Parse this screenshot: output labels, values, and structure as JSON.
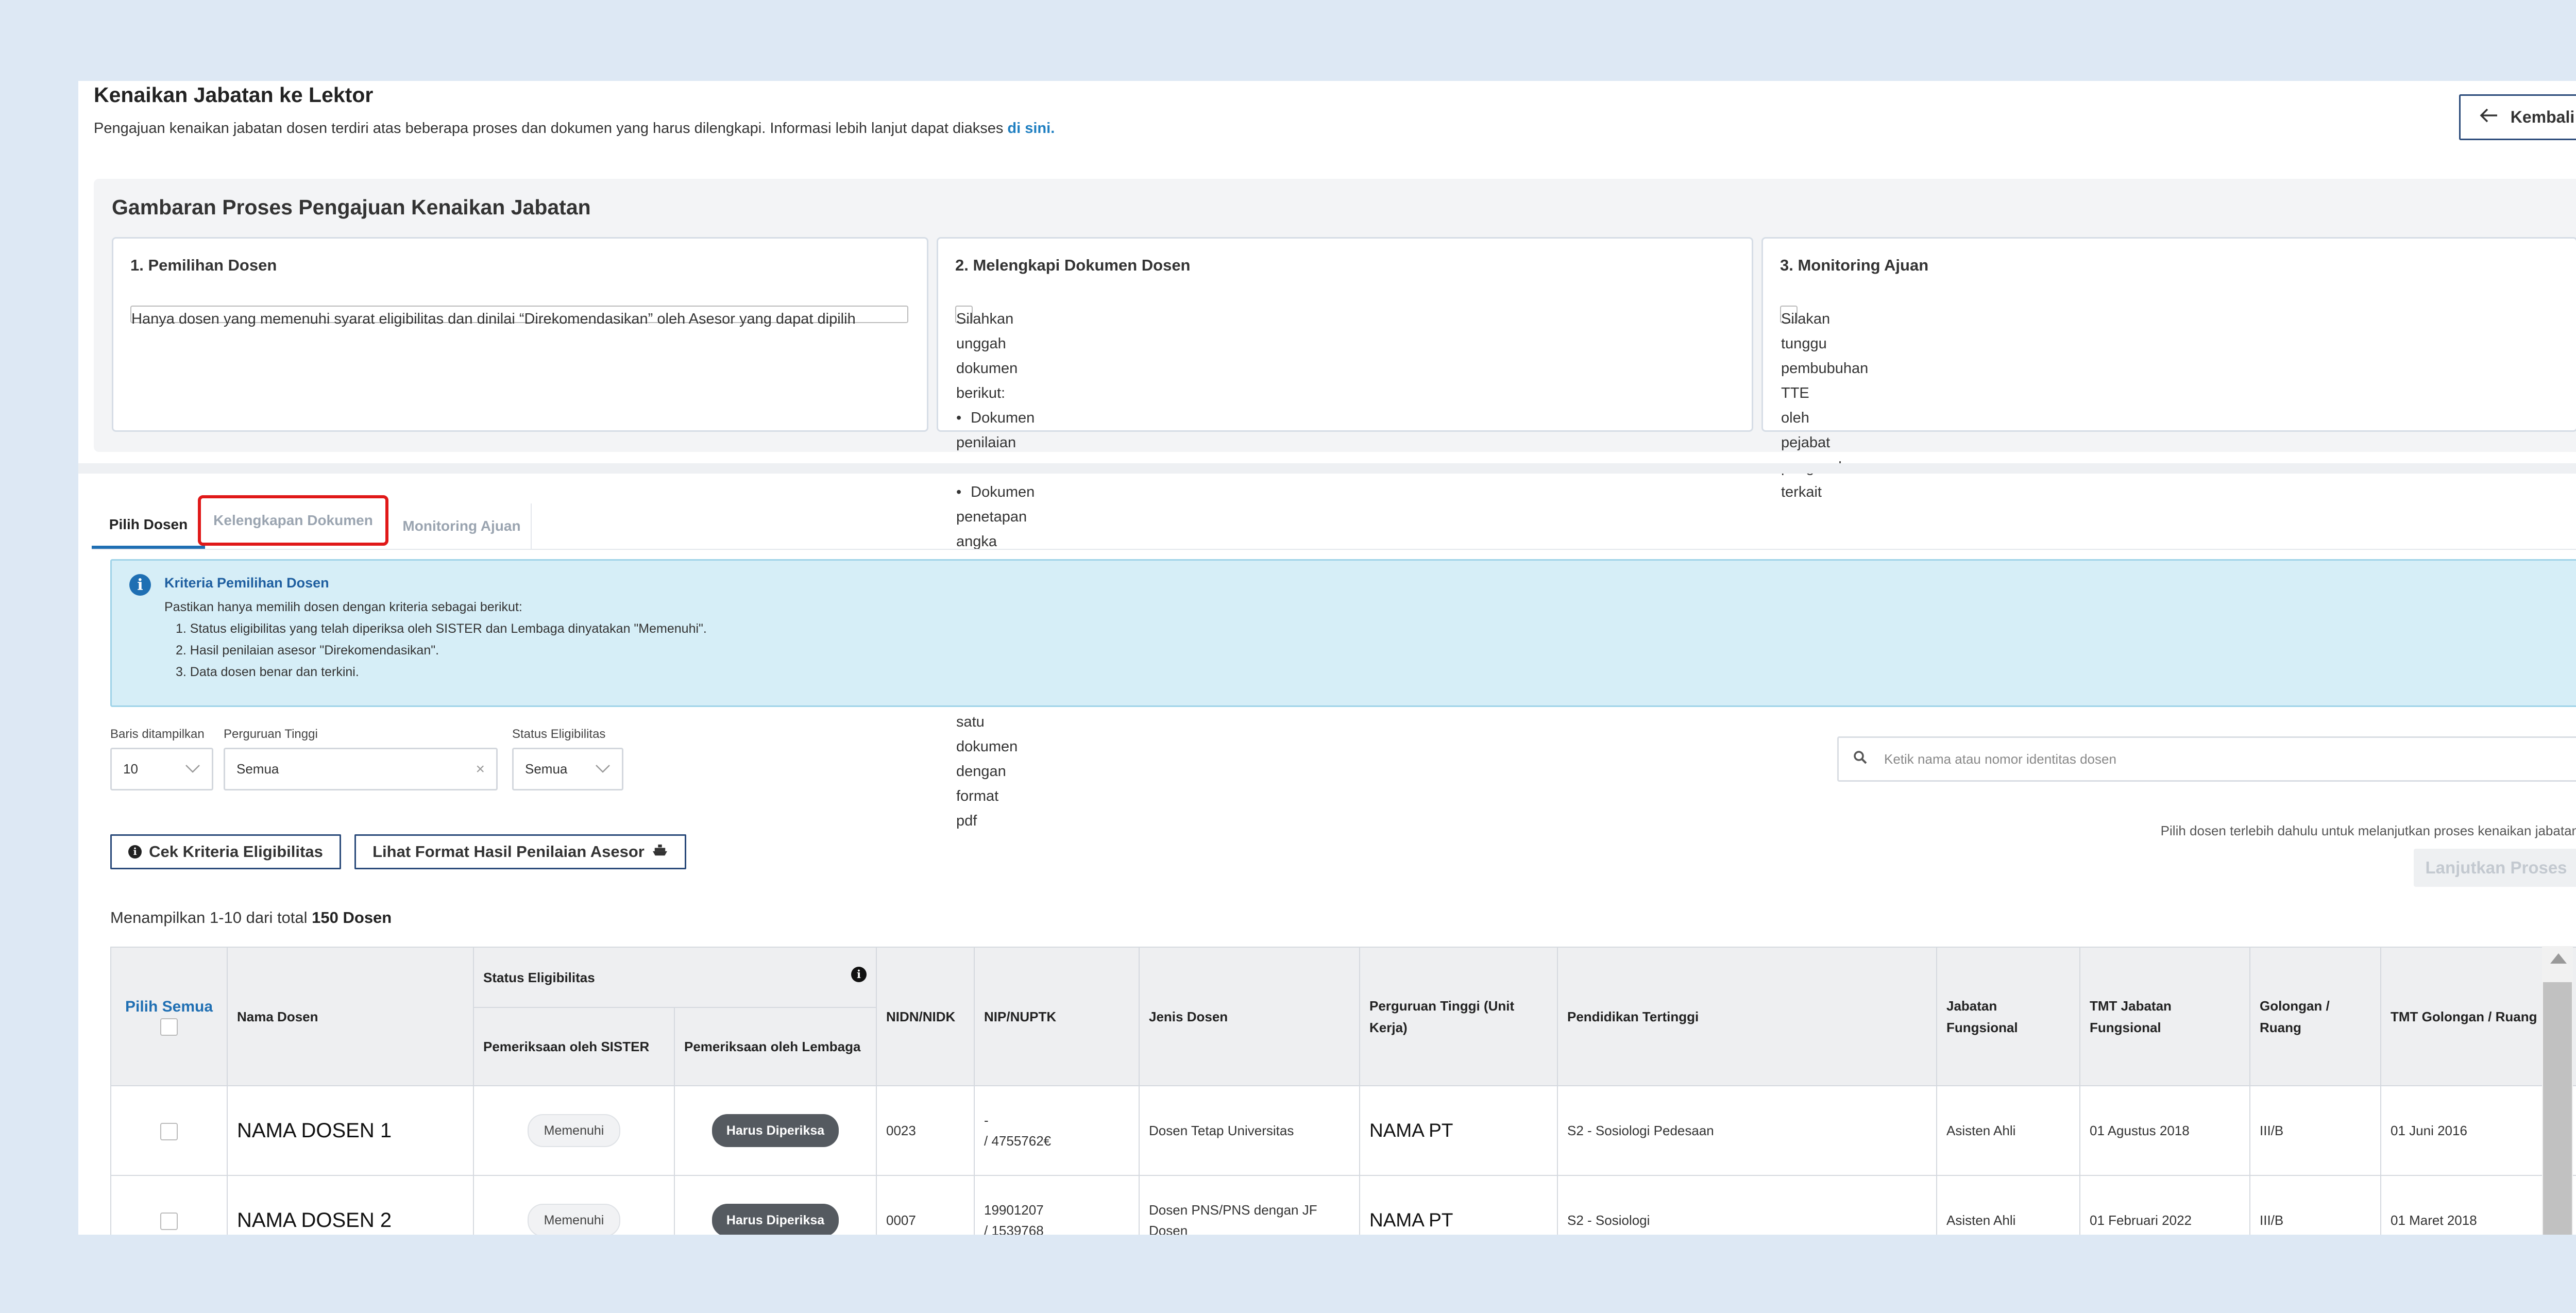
{
  "header": {
    "title": "Kenaikan Jabatan ke Lektor",
    "description": "Pengajuan kenaikan jabatan dosen terdiri atas beberapa proses dan dokumen yang harus dilengkapi. Informasi lebih lanjut dapat diakses ",
    "link_text": "di sini",
    "link_suffix": ".",
    "back_label": "Kembali"
  },
  "process": {
    "title": "Gambaran Proses Pengajuan Kenaikan Jabatan",
    "cards": [
      {
        "title": "1. Pemilihan Dosen",
        "body": "Hanya dosen yang memenuhi syarat eligibilitas dan dinilai “Direkomendasikan” oleh Asesor yang dapat dipilih"
      },
      {
        "title": "2. Melengkapi Dokumen Dosen",
        "intro": "Silahkan unggah dokumen berikut:",
        "items": [
          "Dokumen penilaian asesor.",
          "Dokumen penetapan angka kredit."
        ],
        "note": "Mohon untuk mengunggah keduanya dalam satu dokumen dengan format pdf"
      },
      {
        "title": "3. Monitoring Ajuan",
        "body": "Silakan tunggu pembubuhan TTE oleh pejabat pengesah terkait"
      }
    ]
  },
  "tabs": [
    {
      "label": "Pilih Dosen",
      "active": true
    },
    {
      "label": "Kelengkapan Dokumen",
      "active": false,
      "highlighted": true
    },
    {
      "label": "Monitoring Ajuan",
      "active": false
    }
  ],
  "info": {
    "title": "Kriteria Pemilihan Dosen",
    "text": "Pastikan hanya memilih dosen dengan kriteria sebagai berikut:",
    "items": [
      "1. Status eligibilitas yang telah diperiksa oleh SISTER dan Lembaga dinyatakan \"Memenuhi\".",
      "2. Hasil penilaian asesor \"Direkomendasikan\".",
      "3. Data dosen benar dan terkini."
    ]
  },
  "filters": {
    "rows_label": "Baris ditampilkan",
    "rows_value": "10",
    "pt_label": "Perguruan Tinggi",
    "pt_value": "Semua",
    "pt_clear": "×",
    "status_label": "Status Eligibilitas",
    "status_value": "Semua",
    "search_placeholder": "Ketik nama atau nomor identitas dosen"
  },
  "actions": {
    "cek_label": "Cek Kriteria Eligibilitas",
    "format_label": "Lihat Format Hasil Penilaian Asesor",
    "hint": "Pilih dosen terlebih dahulu untuk melanjutkan proses kenaikan jabatan",
    "lanjut_label": "Lanjutkan Proses"
  },
  "summary": {
    "prefix": "Menampilkan 1-10 dari total ",
    "total": "150 Dosen"
  },
  "table": {
    "pilih_semua": "Pilih Semua",
    "headers": {
      "nama": "Nama Dosen",
      "status_group": "Status Eligibilitas",
      "sister": "Pemeriksaan oleh SISTER",
      "lembaga": "Pemeriksaan oleh Lembaga",
      "nidn": "NIDN/NIDK",
      "nip": "NIP/NUPTK",
      "jenis": "Jenis Dosen",
      "pt": "Perguruan Tinggi (Unit Kerja)",
      "pendidikan": "Pendidikan Tertinggi",
      "jabatan": "Jabatan Fungsional",
      "tmt_jabatan": "TMT Jabatan Fungsional",
      "golongan": "Golongan / Ruang",
      "tmt_golongan": "TMT Golongan / Ruang"
    },
    "rows": [
      {
        "nama": "NAMA DOSEN 1",
        "sister": "Memenuhi",
        "lembaga": "Harus Diperiksa",
        "nidn": "0023",
        "nip_line1": "-",
        "nip_line2": "/ 4755762€",
        "jenis": "Dosen Tetap Universitas",
        "pt": "NAMA PT",
        "pendidikan": "S2 - Sosiologi Pedesaan",
        "jabatan": "Asisten Ahli",
        "tmt_jabatan": "01 Agustus 2018",
        "golongan": "III/B",
        "tmt_golongan": "01 Juni 2016"
      },
      {
        "nama": "NAMA DOSEN 2",
        "sister": "Memenuhi",
        "lembaga": "Harus Diperiksa",
        "nidn": "0007",
        "nip_line1": "19901207",
        "nip_line2": "/ 1539768",
        "jenis": "Dosen PNS/PNS dengan JF Dosen",
        "pt": "NAMA PT",
        "pendidikan": "S2 - Sosiologi",
        "jabatan": "Asisten Ahli",
        "tmt_jabatan": "01 Februari 2022",
        "golongan": "III/B",
        "tmt_golongan": "01 Maret 2018"
      }
    ]
  },
  "colors": {
    "background": "#dde8f4",
    "accent": "#1f6fb3",
    "highlight": "#e01818",
    "info_bg": "#d6eef7"
  }
}
